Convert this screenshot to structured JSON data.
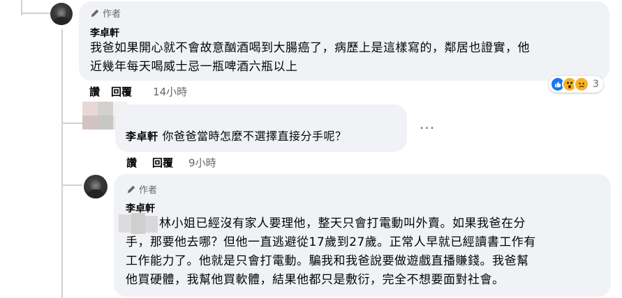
{
  "comments": [
    {
      "author_badge": "作者",
      "name": "李卓軒",
      "lines": [
        "我爸如果開心就不會故意酗酒喝到大腸癌了，病歷上是這樣寫的，鄰居也證實，他",
        "近幾年每天喝威士忌一瓶啤酒六瓶以上"
      ],
      "like_label": "讚",
      "reply_label": "回覆",
      "time": "14小時",
      "reactions": {
        "icons": [
          "like-icon",
          "wow-icon",
          "sad-icon"
        ],
        "count": "3",
        "colors": {
          "like": "#1877f2",
          "wow": "#f7b125",
          "sad": "#f7b125"
        }
      }
    },
    {
      "name": "李卓軒",
      "text": "你爸爸當時怎麼不選擇直接分手呢？",
      "like_label": "讚",
      "reply_label": "回覆",
      "time": "9小時"
    },
    {
      "author_badge": "作者",
      "name": "李卓軒",
      "lines": [
        "林小姐已經沒有家人要理他，整天只會打電動叫外賣。如果我爸在分",
        "手，那要他去哪？但他一直逃避從17歲到27歲。正常人早就已經讀書工作有",
        "工作能力了。他就是只會打電動。騙我和我爸說要做遊戲直播賺錢。我爸幫",
        "他買硬體，我幫他買軟體，結果他都只是敷衍，完全不想要面對社會。"
      ]
    }
  ],
  "colors": {
    "bubble": "#f0f2f5",
    "thread_line": "#ced0d4",
    "secondary_text": "#65676b"
  }
}
